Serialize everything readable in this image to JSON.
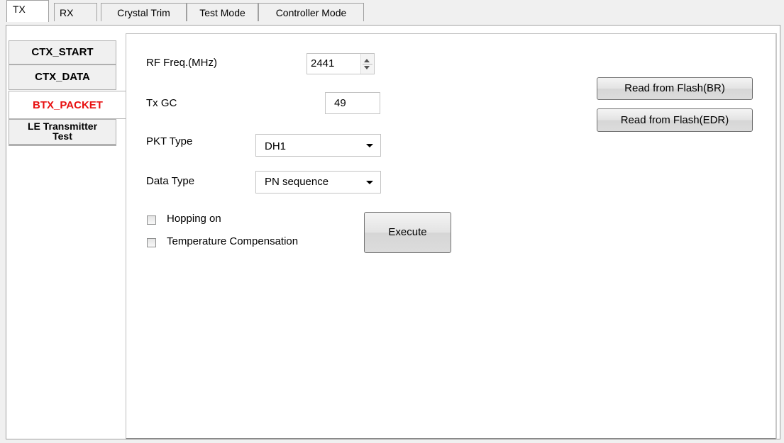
{
  "top_tabs": [
    "TX",
    "RX",
    "Crystal Trim",
    "Test Mode",
    "Controller Mode"
  ],
  "side_tabs": [
    "CTX_START",
    "CTX_DATA",
    "BTX_PACKET",
    "LE Transmitter",
    "Test"
  ],
  "form": {
    "rf_freq_label": "RF Freq.(MHz)",
    "rf_freq_value": "2441",
    "tx_gc_label": "Tx GC",
    "tx_gc_value": "49",
    "pkt_type_label": "PKT Type",
    "pkt_type_value": "DH1",
    "data_type_label": "Data Type",
    "data_type_value": "PN sequence",
    "hopping_label": "Hopping on",
    "temp_comp_label": "Temperature Compensation",
    "execute_label": "Execute"
  },
  "buttons": {
    "read_br": "Read from Flash(BR)",
    "read_edr": "Read from Flash(EDR)"
  },
  "colors": {
    "active_side_tab_text": "#e81010"
  }
}
